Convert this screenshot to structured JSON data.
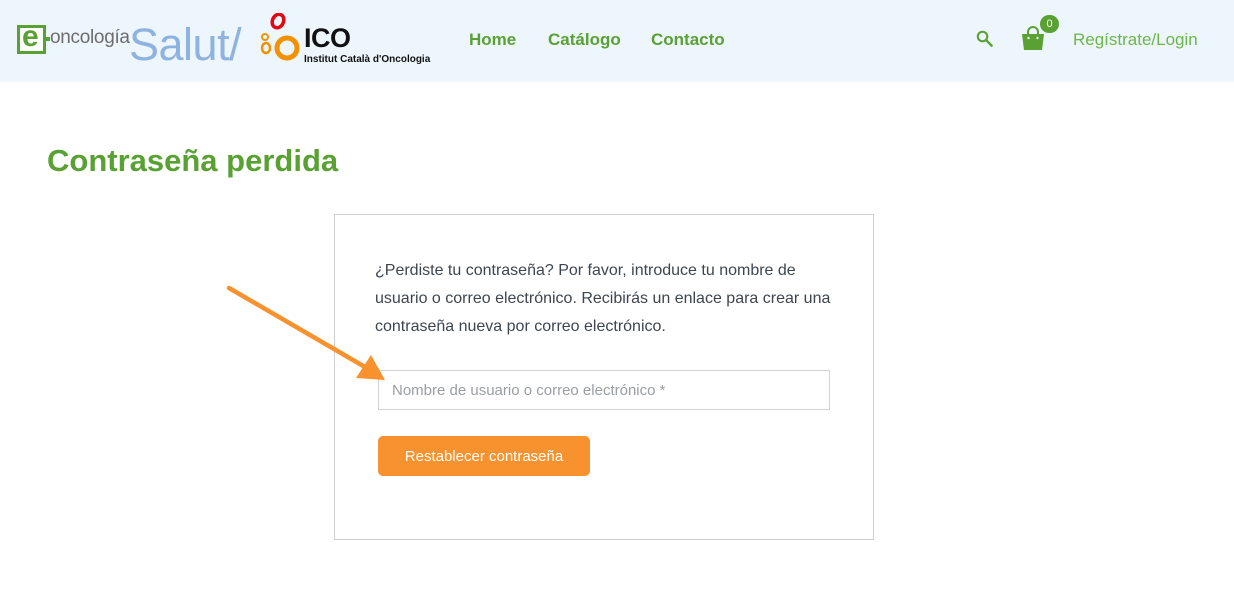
{
  "header": {
    "logo_eoncologia_letter": "e",
    "logo_eoncologia_text": "oncología",
    "logo_salut_text": "Salut/",
    "logo_ico_text": "ICO",
    "logo_ico_subtitle": "Institut Català d'Oncologia",
    "nav": [
      {
        "label": "Home"
      },
      {
        "label": "Catálogo"
      },
      {
        "label": "Contacto"
      }
    ],
    "search_icon": "search-icon",
    "cart_icon": "shopping-bag-icon",
    "cart_count": "0",
    "login_label": "Regístrate/Login",
    "background_color": "#eef6fd",
    "accent_color": "#5aa133"
  },
  "page": {
    "title": "Contraseña perdida"
  },
  "form": {
    "instructions": "¿Perdiste tu contraseña? Por favor, introduce tu nombre de usuario o correo electrónico. Recibirás un enlace para crear una contraseña nueva por correo electrónico.",
    "username_placeholder": "Nombre de usuario o correo electrónico *",
    "username_value": "",
    "submit_label": "Restablecer contraseña",
    "button_color": "#f7922f"
  },
  "annotation": {
    "arrow_icon": "arrow-icon",
    "arrow_color": "#f7922f"
  }
}
